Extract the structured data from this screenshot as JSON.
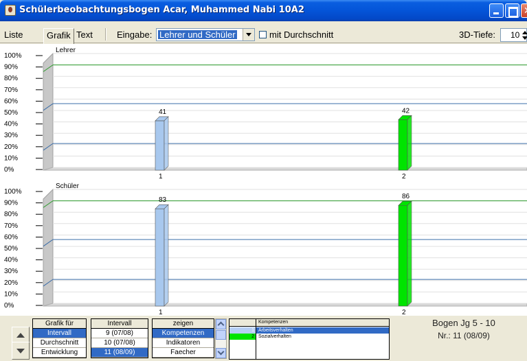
{
  "window": {
    "title": "Schülerbeobachtungsbogen Acar, Muhammed Nabi 10A2"
  },
  "toolbar": {
    "tabs": [
      "Liste",
      "Grafik",
      "Text"
    ],
    "eingabe_label": "Eingabe:",
    "eingabe_value": "Lehrer und Schüler",
    "checkbox_label": "mit Durchschnitt",
    "checkbox_checked": false,
    "tiefe_label": "3D-Tiefe:",
    "tiefe_value": "10"
  },
  "colors": {
    "bar1": "#a8c8ee",
    "bar2": "#00e400",
    "band_top": "#2a9a2a",
    "band_mid": "#3a6ca8",
    "band_low": "#3a6ca8"
  },
  "chart_data": [
    {
      "type": "bar",
      "title": "Lehrer",
      "categories": [
        "1",
        "2"
      ],
      "values": [
        41,
        42
      ],
      "ylim": [
        0,
        100
      ],
      "yticks": [
        "0%",
        "10%",
        "20%",
        "30%",
        "40%",
        "50%",
        "60%",
        "70%",
        "80%",
        "90%",
        "100%"
      ],
      "reference_lines": [
        90,
        56,
        21
      ]
    },
    {
      "type": "bar",
      "title": "Schüler",
      "categories": [
        "1",
        "2"
      ],
      "values": [
        83,
        86
      ],
      "ylim": [
        0,
        100
      ],
      "yticks": [
        "0%",
        "10%",
        "20%",
        "30%",
        "40%",
        "50%",
        "60%",
        "70%",
        "80%",
        "90%",
        "100%"
      ],
      "reference_lines": [
        90,
        56,
        21
      ]
    }
  ],
  "bottom": {
    "grafik_fuer": {
      "header": "Grafik für",
      "items": [
        "Intervall",
        "Durchschnitt",
        "Entwicklung"
      ],
      "selected": 0
    },
    "intervall": {
      "header": "Intervall",
      "items": [
        "9 (07/08)",
        "10 (07/08)",
        "11 (08/09)"
      ],
      "selected": 2
    },
    "zeigen": {
      "header": "zeigen",
      "items": [
        "Kompetenzen",
        "Indikatoren",
        "Faecher"
      ],
      "selected": 0
    },
    "kompetenzen": {
      "header": "Kompetenzen",
      "rows": [
        {
          "num": "1",
          "label": "Arbeitsverhalten"
        },
        {
          "num": "2",
          "label": "Sozialverhalten"
        }
      ]
    },
    "bogen": "Bogen Jg 5 - 10",
    "nr": "Nr.: 11 (08/09)"
  }
}
